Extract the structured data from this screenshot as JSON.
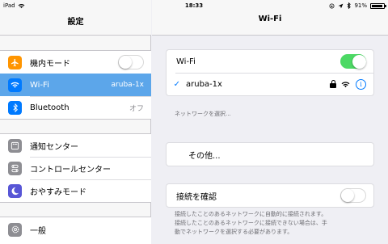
{
  "status_bar": {
    "device": "iPad",
    "time": "18:33",
    "battery_percent": "91%"
  },
  "master": {
    "title": "設定",
    "group1": [
      {
        "label": "機内モード",
        "icon": "airplane-icon",
        "color": "#ff9500",
        "toggle": "off"
      },
      {
        "label": "Wi-Fi",
        "icon": "wifi-icon",
        "color": "#007aff",
        "value": "aruba-1x",
        "selected": true
      },
      {
        "label": "Bluetooth",
        "icon": "bluetooth-icon",
        "color": "#007aff",
        "value": "オフ"
      }
    ],
    "group2": [
      {
        "label": "通知センター",
        "icon": "notification-icon",
        "color": "#8e8e93"
      },
      {
        "label": "コントロールセンター",
        "icon": "control-center-icon",
        "color": "#8e8e93"
      },
      {
        "label": "おやすみモード",
        "icon": "moon-icon",
        "color": "#5856d6"
      }
    ],
    "group3": [
      {
        "label": "一般",
        "icon": "gear-icon",
        "color": "#8e8e93"
      }
    ]
  },
  "detail": {
    "title": "Wi-Fi",
    "wifi_label": "Wi-Fi",
    "wifi_toggle": "on",
    "connected_network": "aruba-1x",
    "choose_network_label": "ネットワークを選択...",
    "other_label": "その他...",
    "ask_to_join_label": "接続を確認",
    "ask_to_join_toggle": "off",
    "footer_line1": "接続したことのあるネットワークに自動的に接続されます。",
    "footer_line2": "接続したことのあるネットワークに接続できない場合は、手",
    "footer_line3": "動でネットワークを選択する必要があります。"
  },
  "colors": {
    "accent": "#007aff",
    "selected_row": "#5ca6ea",
    "toggle_on": "#4cd964"
  }
}
